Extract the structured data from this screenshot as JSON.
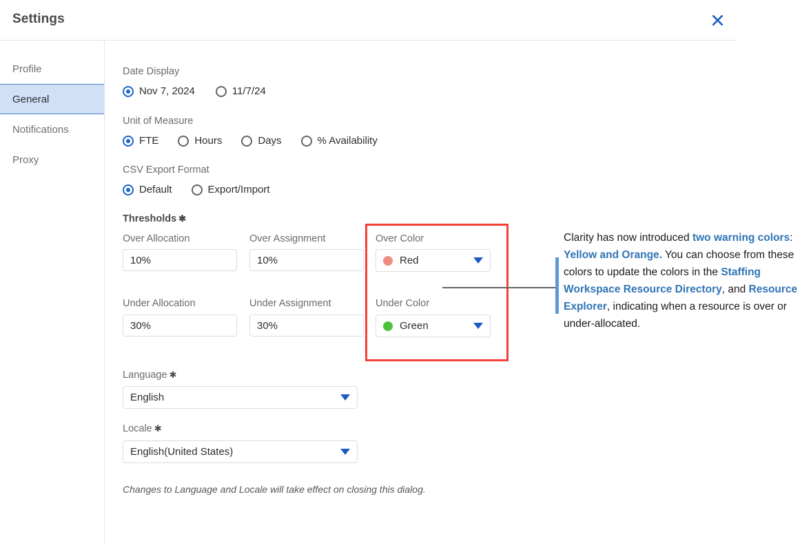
{
  "dialog": {
    "title": "Settings",
    "close_icon": "close-icon"
  },
  "sidebar": {
    "items": [
      {
        "label": "Profile",
        "active": false
      },
      {
        "label": "General",
        "active": true
      },
      {
        "label": "Notifications",
        "active": false
      },
      {
        "label": "Proxy",
        "active": false
      }
    ]
  },
  "general": {
    "date_display": {
      "label": "Date Display",
      "options": [
        {
          "label": "Nov 7, 2024",
          "checked": true
        },
        {
          "label": "11/7/24",
          "checked": false
        }
      ]
    },
    "unit_of_measure": {
      "label": "Unit of Measure",
      "options": [
        {
          "label": "FTE",
          "checked": true
        },
        {
          "label": "Hours",
          "checked": false
        },
        {
          "label": "Days",
          "checked": false
        },
        {
          "label": "% Availability",
          "checked": false
        }
      ]
    },
    "csv_export_format": {
      "label": "CSV Export Format",
      "options": [
        {
          "label": "Default",
          "checked": true
        },
        {
          "label": "Export/Import",
          "checked": false
        }
      ]
    },
    "thresholds": {
      "label": "Thresholds",
      "required_marker": "✱",
      "over_allocation": {
        "label": "Over Allocation",
        "value": "10%"
      },
      "over_assignment": {
        "label": "Over Assignment",
        "value": "10%"
      },
      "under_allocation": {
        "label": "Under Allocation",
        "value": "30%"
      },
      "under_assignment": {
        "label": "Under Assignment",
        "value": "30%"
      },
      "over_color": {
        "label": "Over Color",
        "value": "Red",
        "swatch_hex": "#f08c82"
      },
      "under_color": {
        "label": "Under Color",
        "value": "Green",
        "swatch_hex": "#4cc23a"
      }
    },
    "language": {
      "label": "Language",
      "required_marker": "✱",
      "value": "English"
    },
    "locale": {
      "label": "Locale",
      "required_marker": "✱",
      "value": "English(United States)"
    },
    "note": "Changes to Language and Locale will take effect on closing this dialog."
  },
  "annotation": {
    "segments": [
      {
        "text": "Clarity has now introduced ",
        "bold": false
      },
      {
        "text": "two warning colors",
        "bold": true
      },
      {
        "text": ": ",
        "bold": false
      },
      {
        "text": "Yellow and Orange.",
        "bold": true
      },
      {
        "text": " You can choose from these colors to update the colors in the ",
        "bold": false
      },
      {
        "text": "Staffing Workspace Resource Directory",
        "bold": true
      },
      {
        "text": ", and ",
        "bold": false
      },
      {
        "text": "Resource Explorer",
        "bold": true
      },
      {
        "text": ", indicating when a resource is over or under-allocated.",
        "bold": false
      }
    ]
  },
  "colors": {
    "accent_blue": "#1864c8",
    "highlight_red": "#f4403a",
    "callout_blue": "#5b9bd5",
    "link_blue": "#2e74b5"
  }
}
